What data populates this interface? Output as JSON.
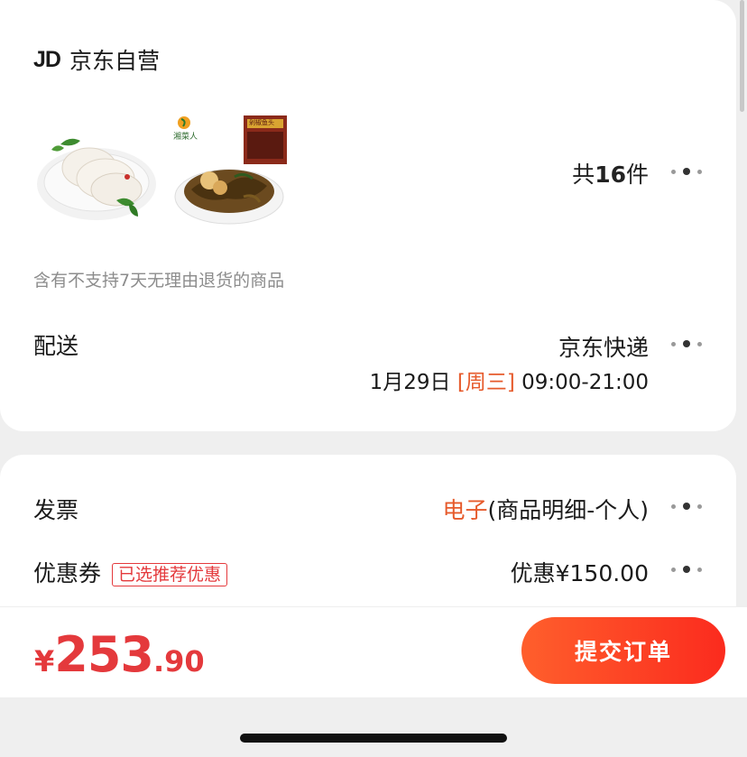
{
  "shop": {
    "logo_text": "JD",
    "name": "京东自营"
  },
  "products": {
    "images": [
      "fish-steak-plate",
      "pickled-vegetable-bowl"
    ],
    "thumb2_brand": "湘菜人",
    "thumb2_pack_text": "剁椒鱼头",
    "count_prefix": "共",
    "count_value": "16",
    "count_suffix": "件"
  },
  "notice": "含有不支持7天无理由退货的商品",
  "delivery": {
    "label": "配送",
    "carrier": "京东快递",
    "date": "1月29日",
    "weekday": "[周三]",
    "time": "09:00-21:00"
  },
  "invoice": {
    "label": "发票",
    "type": "电子",
    "detail": "(商品明细-个人)"
  },
  "coupon": {
    "label": "优惠券",
    "tag": "已选推荐优惠",
    "value": "优惠¥150.00"
  },
  "footer": {
    "currency": "¥",
    "price_int": "253",
    "price_dec": ".90",
    "submit_label": "提交订单"
  },
  "colors": {
    "accent": "#e4393c",
    "button_start": "#ff5f2c",
    "button_end": "#fb2b1e"
  }
}
